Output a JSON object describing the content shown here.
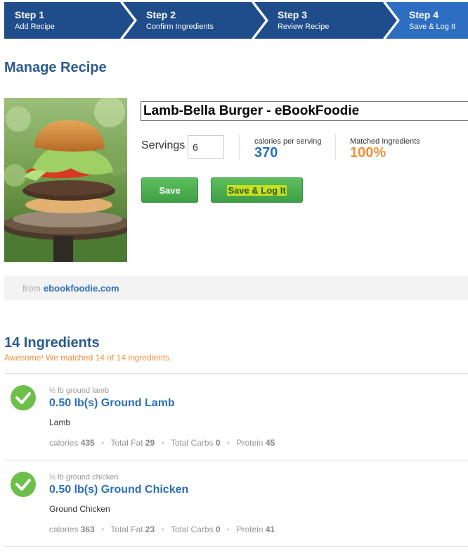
{
  "steps": [
    {
      "num": "Step 1",
      "label": "Add Recipe"
    },
    {
      "num": "Step 2",
      "label": "Confirm Ingredients"
    },
    {
      "num": "Step 3",
      "label": "Review Recipe"
    },
    {
      "num": "Step 4",
      "label": "Save & Log It"
    }
  ],
  "colors": {
    "step_bg": "#1f4d8c",
    "step_active": "#2e6ec2",
    "accent_blue": "#2b6fb8",
    "accent_orange": "#f0903a",
    "green": "#6cc04a"
  },
  "page_title": "Manage Recipe",
  "recipe": {
    "name": "Lamb-Bella Burger - eBookFoodie",
    "servings_label": "Servings",
    "servings_value": "6",
    "calories_label": "calories per serving",
    "calories_value": "370",
    "matched_label": "Matched Ingredients",
    "matched_value": "100%"
  },
  "buttons": {
    "save": "Save",
    "save_log": "Save & Log It"
  },
  "source": {
    "from": "from",
    "link": "ebookfoodie.com"
  },
  "ingredients_heading": "14 Ingredients",
  "ingredients_sub": "Awesome! We matched 14 of 14 ingredients.",
  "ingredients": [
    {
      "original": "½ lb ground lamb",
      "title": "0.50 lb(s) Ground Lamb",
      "food": "Lamb",
      "calories_label": "calories",
      "calories": "435",
      "fat_label": "Total Fat",
      "fat": "29",
      "carbs_label": "Total Carbs",
      "carbs": "0",
      "protein_label": "Protein",
      "protein": "45"
    },
    {
      "original": "½ lb ground chicken",
      "title": "0.50 lb(s) Ground Chicken",
      "food": "Ground Chicken",
      "calories_label": "calories",
      "calories": "363",
      "fat_label": "Total Fat",
      "fat": "23",
      "carbs_label": "Total Carbs",
      "carbs": "0",
      "protein_label": "Protein",
      "protein": "41"
    }
  ]
}
